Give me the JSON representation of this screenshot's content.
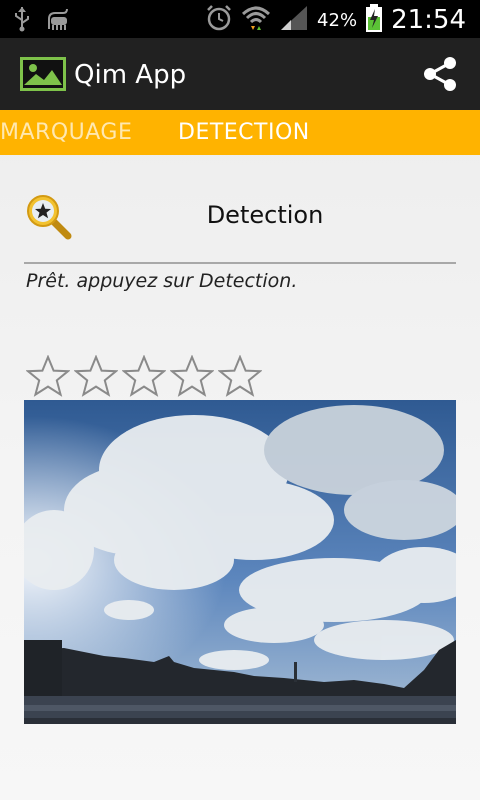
{
  "status_bar": {
    "battery_percent": "42%",
    "time": "21:54",
    "icons": [
      "usb-icon",
      "android-debug-icon",
      "alarm-icon",
      "wifi-icon",
      "signal-icon",
      "battery-charging-icon"
    ]
  },
  "action_bar": {
    "title": "Qim App",
    "icon": "image-icon",
    "share_icon": "share-icon"
  },
  "tabs": [
    {
      "label": "MARQUAGE",
      "selected": false
    },
    {
      "label": "DETECTION",
      "selected": true
    }
  ],
  "detection": {
    "title": "Detection",
    "icon": "search-star-icon",
    "status": "Prêt. appuyez sur Detection."
  },
  "rating": {
    "value": 0,
    "max": 5
  },
  "photo": {
    "icon": "photo-image",
    "description_colors": {
      "sky": "#3b6aa8",
      "cloud": "#e8ecef",
      "river": "#2a2f38"
    }
  },
  "colors": {
    "accent": "#ffb300",
    "action_bar": "#212121",
    "status_bar": "#000000"
  }
}
